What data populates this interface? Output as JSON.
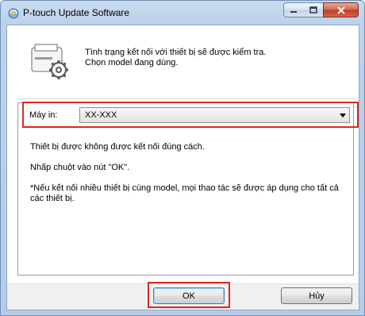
{
  "window": {
    "title": "P-touch Update Software"
  },
  "header": {
    "line1": "Tình trạng kết nối với thiết bị sẽ được kiểm tra.",
    "line2": "Chọn model đang dùng.",
    "icon": "printer-gear-icon"
  },
  "printer": {
    "label": "Máy in:",
    "selected": "XX-XXX"
  },
  "messages": {
    "line1": "Thiết bị được không được kết nối đúng cách.",
    "line2": "Nhấp chuột vào nút \"OK\".",
    "line3": "*Nếu kết nối nhiều thiết bị cùng model, mọi thao tác sẽ được áp dụng cho tất cả các thiết bị."
  },
  "buttons": {
    "ok": "OK",
    "cancel": "Hủy"
  },
  "colors": {
    "highlight": "#e1261c"
  }
}
